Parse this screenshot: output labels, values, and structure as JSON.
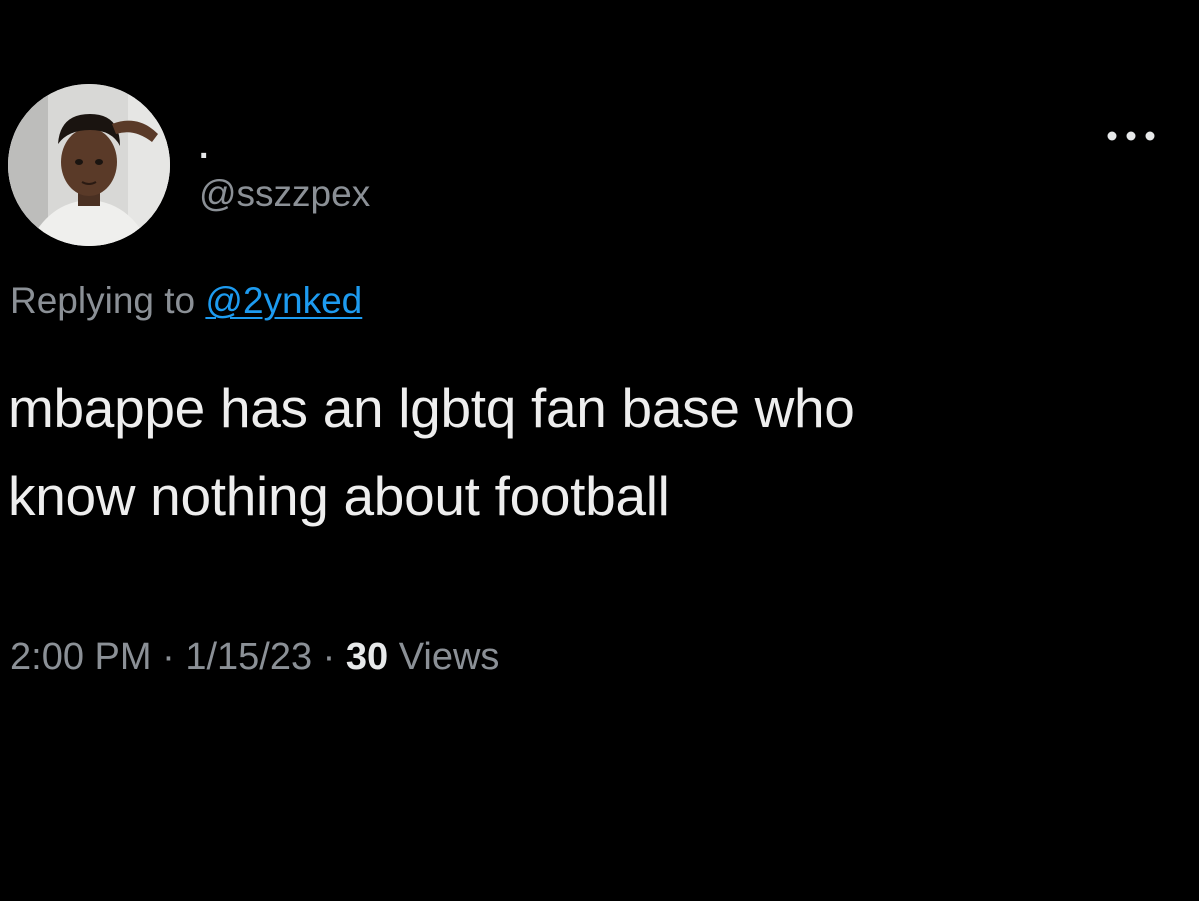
{
  "tweet": {
    "display_name": ".",
    "handle": "@sszzpex",
    "reply_prefix": "Replying to",
    "reply_handle": "@2ynked",
    "text_lines": [
      "mbappe has an lgbtq fan base who",
      "know nothing about football"
    ],
    "time": "2:00 PM",
    "separator": "·",
    "date": "1/15/23",
    "views_count": "30",
    "views_label": "Views",
    "avatar_icon": "user-avatar-photo",
    "more_icon": "more-options-icon"
  },
  "colors": {
    "background": "#000000",
    "primary_text": "#e7e9ea",
    "secondary_text": "#8b9096",
    "link": "#1d9bf0"
  }
}
